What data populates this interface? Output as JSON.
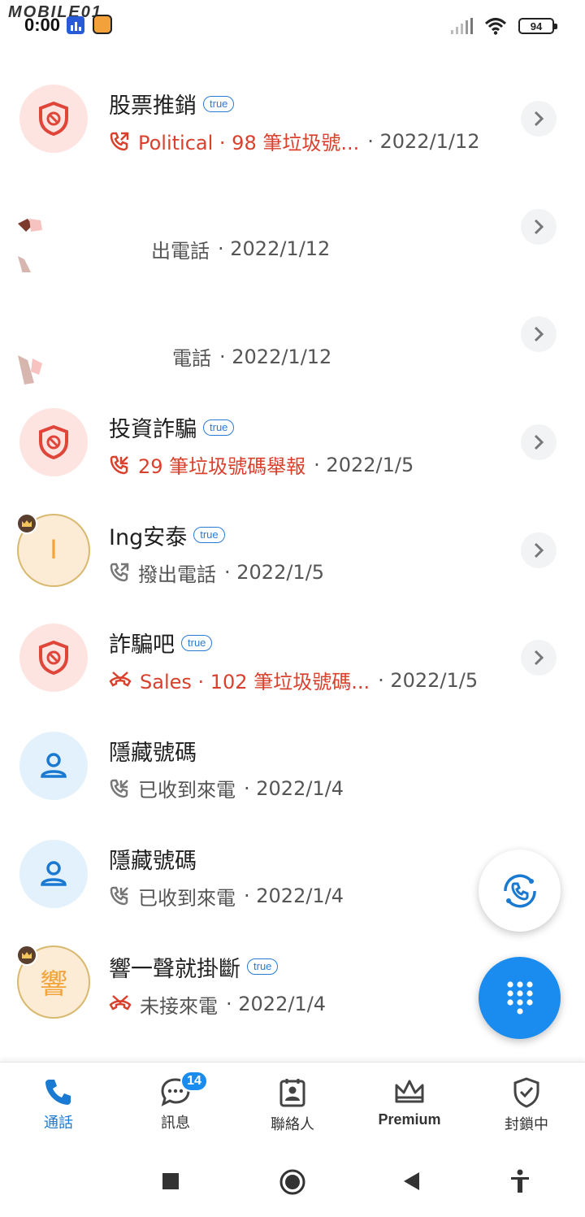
{
  "status_bar": {
    "watermark": "MOBILE01",
    "time": "0:00",
    "battery": "94"
  },
  "calls": [
    {
      "title": "股票推銷",
      "tag": "true",
      "sub_red": "Political · 98 筆垃圾號...",
      "date": "· 2022/1/12",
      "avatar": "spam",
      "call_icon": "outgoing-red"
    },
    {
      "title": "",
      "tag": "",
      "sub_red": "",
      "sub_text": "出電話",
      "date": "· 2022/1/12",
      "avatar": "redacted",
      "call_icon": "none"
    },
    {
      "title": "",
      "tag": "",
      "sub_red": "",
      "sub_text": "電話",
      "date": "· 2022/1/12",
      "avatar": "redacted",
      "call_icon": "none"
    },
    {
      "title": "投資詐騙",
      "tag": "true",
      "sub_red": "29 筆垃圾號碼舉報",
      "date": "· 2022/1/5",
      "avatar": "spam",
      "call_icon": "incoming-red"
    },
    {
      "title": "Ing安泰",
      "tag": "true",
      "sub_text": "撥出電話",
      "date": "· 2022/1/5",
      "avatar": "gold",
      "avatar_letter": "I",
      "call_icon": "outgoing-gray"
    },
    {
      "title": "詐騙吧",
      "tag": "true",
      "sub_red": "Sales · 102 筆垃圾號碼...",
      "date": "· 2022/1/5",
      "avatar": "spam",
      "call_icon": "missed-red"
    },
    {
      "title": "隱藏號碼",
      "tag": "",
      "sub_text": "已收到來電",
      "date": "· 2022/1/4",
      "avatar": "person",
      "call_icon": "incoming-gray"
    },
    {
      "title": "隱藏號碼",
      "tag": "",
      "sub_text": "已收到來電",
      "date": "· 2022/1/4",
      "avatar": "person",
      "call_icon": "incoming-gray"
    },
    {
      "title": "響一聲就掛斷",
      "tag": "true",
      "sub_text": "未接來電",
      "date": "· 2022/1/4",
      "avatar": "gold",
      "avatar_letter": "響",
      "call_icon": "missed-red"
    }
  ],
  "nav": {
    "calls": "通話",
    "messages": "訊息",
    "messages_badge": "14",
    "contacts": "聯絡人",
    "premium": "Premium",
    "blocking": "封鎖中"
  },
  "colors": {
    "accent": "#1a8cf0",
    "spam_red": "#d9412d",
    "gold": "#f2a43a"
  }
}
